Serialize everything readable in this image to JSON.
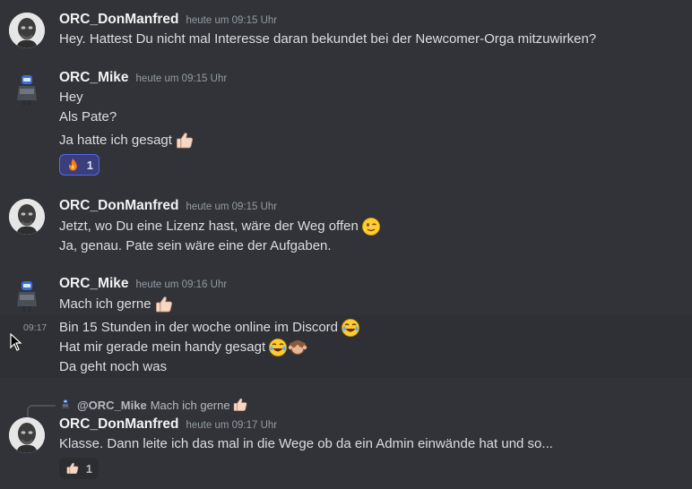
{
  "messages": [
    {
      "author": "ORC_DonManfred",
      "time": "heute um 09:15 Uhr",
      "lines": [
        "Hey. Hattest Du nicht mal Interesse daran bekundet bei der Newcomer-Orga mitzuwirken?"
      ]
    },
    {
      "author": "ORC_Mike",
      "time": "heute um 09:15 Uhr",
      "lines": [
        "Hey",
        "Als Pate?",
        "Ja hatte ich gesagt"
      ],
      "reaction": {
        "emoji": "fire-emoji",
        "count": "1"
      }
    },
    {
      "author": "ORC_DonManfred",
      "time": "heute um 09:15 Uhr",
      "lines": [
        "Jetzt, wo Du eine Lizenz hast, wäre der Weg offen",
        "Ja, genau. Pate sein wäre eine der Aufgaben."
      ]
    },
    {
      "author": "ORC_Mike",
      "time": "heute um 09:16 Uhr",
      "lines": [
        "Mach ich gerne"
      ],
      "followup_time": "09:17",
      "followup_lines": [
        "Bin 15 Stunden in der woche online im Discord",
        "Hat mir gerade mein handy gesagt",
        "Da geht noch was"
      ]
    },
    {
      "reply": {
        "mention": "@ORC_Mike",
        "text": "Mach ich gerne"
      },
      "author": "ORC_DonManfred",
      "time": "heute um 09:17 Uhr",
      "lines": [
        "Klasse. Dann leite ich das mal in die Wege ob da ein Admin einwände hat und so..."
      ],
      "reaction": {
        "emoji": "thumbs-up-emoji",
        "count": "1"
      }
    }
  ],
  "colors": {
    "background": "#313338",
    "hover_background": "#2e3035",
    "username": "#f2f3f5",
    "text": "#dbdee1",
    "timestamp": "#949ba4",
    "reaction_active_border": "#5865f2"
  }
}
